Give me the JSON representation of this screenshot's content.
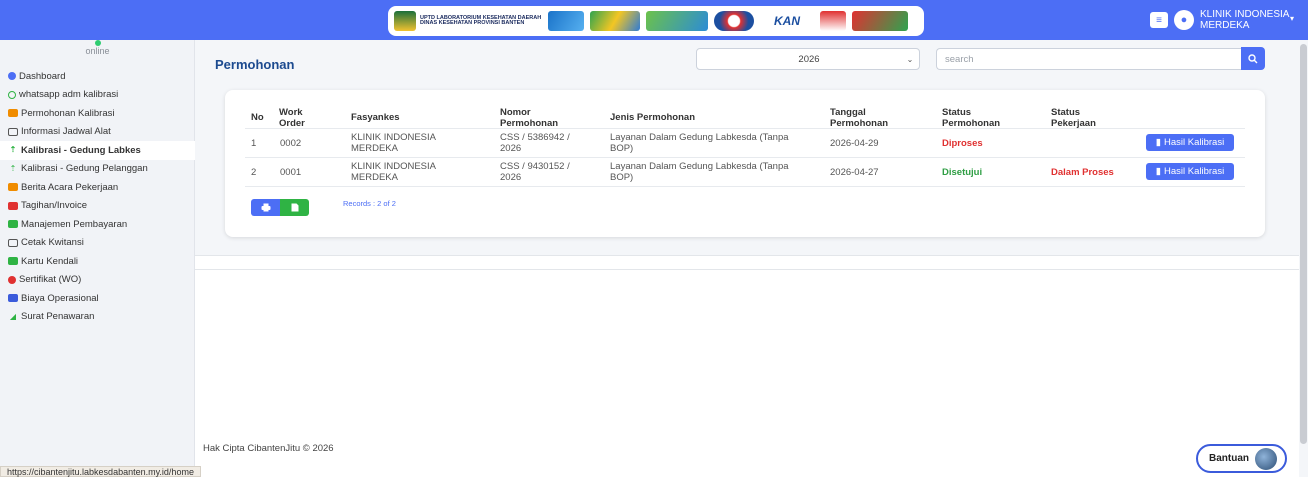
{
  "header": {
    "logo_line1": "UPTD LABORATORIUM KESEHATAN DAERAH",
    "logo_line2": "DINAS KESEHATAN PROVINSI BANTEN",
    "kan_logo": "KAN",
    "menu_icon": "hamburger-icon",
    "user_icon": "user-circle-icon",
    "user_name": "KLINIK INDONESIA MERDEKA",
    "caret_icon": "chevron-down-icon",
    "brand_color": "#4c6ef5"
  },
  "sidebar": {
    "status": "online",
    "items": [
      {
        "label": "Dashboard",
        "icon": "dashboard-icon"
      },
      {
        "label": "whatsapp adm kalibrasi",
        "icon": "whatsapp-icon"
      },
      {
        "label": "Permohonan Kalibrasi",
        "icon": "folder-icon"
      },
      {
        "label": "Informasi Jadwal Alat",
        "icon": "calendar-icon"
      },
      {
        "label": "Kalibrasi - Gedung Labkes",
        "icon": "upload-icon"
      },
      {
        "label": "Kalibrasi - Gedung Pelanggan",
        "icon": "upload-icon"
      },
      {
        "label": "Berita Acara Pekerjaan",
        "icon": "folder-icon"
      },
      {
        "label": "Tagihan/Invoice",
        "icon": "invoice-icon"
      },
      {
        "label": "Manajemen Pembayaran",
        "icon": "money-icon"
      },
      {
        "label": "Cetak Kwitansi",
        "icon": "print-icon"
      },
      {
        "label": "Kartu Kendali",
        "icon": "card-icon"
      },
      {
        "label": "Sertifikat (WO)",
        "icon": "certificate-icon"
      },
      {
        "label": "Biaya Operasional",
        "icon": "list-icon"
      },
      {
        "label": "Surat Penawaran",
        "icon": "send-icon"
      }
    ],
    "active_item": "Kalibrasi - Gedung Labkes"
  },
  "main": {
    "title": "Permohonan",
    "year_select": "2026",
    "search_placeholder": "search",
    "table": {
      "headers": {
        "no": "No",
        "work_order": "Work Order",
        "fasyankes": "Fasyankes",
        "nomor": "Nomor Permohonan",
        "jenis": "Jenis Permohonan",
        "tanggal": "Tanggal Permohonan",
        "status_permohonan": "Status Permohonan",
        "status_pekerjaan": "Status Pekerjaan"
      },
      "rows": [
        {
          "no": "1",
          "work_order": "0002",
          "fasyankes": "KLINIK INDONESIA MERDEKA",
          "nomor": "CSS / 5386942 / 2026",
          "jenis": "Layanan Dalam Gedung Labkesda (Tanpa BOP)",
          "tanggal": "2026-04-29",
          "status_permohonan": "Diproses",
          "status_pekerjaan": "",
          "action": "Hasil Kalibrasi"
        },
        {
          "no": "2",
          "work_order": "0001",
          "fasyankes": "KLINIK INDONESIA MERDEKA",
          "nomor": "CSS / 9430152 / 2026",
          "jenis": "Layanan Dalam Gedung Labkesda (Tanpa BOP)",
          "tanggal": "2026-04-27",
          "status_permohonan": "Disetujui",
          "status_pekerjaan": "Dalam Proses",
          "action": "Hasil Kalibrasi"
        }
      ],
      "records_text": "Records : 2 of 2"
    }
  },
  "footer": {
    "copyright": "Hak Cipta CibantenJitu © 2026",
    "status_url": "https://cibantenjitu.labkesdabanten.my.id/home",
    "help_label": "Bantuan"
  }
}
